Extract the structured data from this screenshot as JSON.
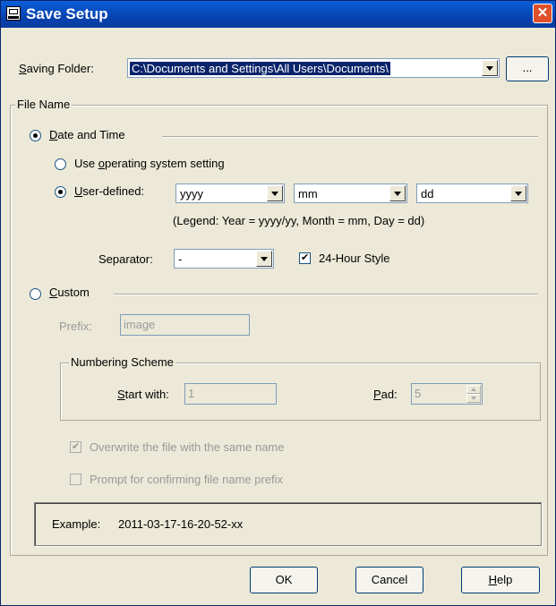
{
  "window": {
    "title": "Save Setup"
  },
  "saving_folder": {
    "label_prefix": "",
    "label_mnemonic": "S",
    "label_rest": "aving Folder:",
    "value": "C:\\Documents and Settings\\All Users\\Documents\\",
    "browse_label": "..."
  },
  "file_name": {
    "group_label": "File Name",
    "date_time": {
      "label_mnemonic": "D",
      "label_rest": "ate and Time",
      "selected": true
    },
    "use_os": {
      "label_pre": "Use ",
      "label_mnemonic": "o",
      "label_rest": "perating system setting",
      "selected": false
    },
    "user_defined": {
      "label_mnemonic": "U",
      "label_rest": "ser-defined:",
      "selected": true
    },
    "year_format": "yyyy",
    "month_format": "mm",
    "day_format": "dd",
    "legend": "(Legend:  Year = yyyy/yy, Month = mm, Day = dd)",
    "separator_label": "Separator:",
    "separator_value": "-",
    "hour24_label": "24-Hour Style",
    "hour24_checked": true,
    "custom": {
      "label_mnemonic": "C",
      "label_rest": "ustom",
      "selected": false
    },
    "prefix_label": "Prefix:",
    "prefix_placeholder": "image",
    "numbering": {
      "group_label": "Numbering Scheme",
      "start_mnemonic": "S",
      "start_rest": "tart with:",
      "start_value": "1",
      "pad_mnemonic": "P",
      "pad_rest": "ad:",
      "pad_value": "5"
    },
    "overwrite_label": "Overwrite the file with the same name",
    "overwrite_checked": true,
    "prompt_label": "Prompt for confirming file name prefix",
    "prompt_checked": false
  },
  "example": {
    "label": "Example:",
    "value": "2011-03-17-16-20-52-xx"
  },
  "buttons": {
    "ok": "OK",
    "cancel": "Cancel",
    "help_mnemonic": "H",
    "help_rest": "elp"
  },
  "icons": {
    "app": "app-window-icon",
    "close": "close-icon",
    "dropdown": "chevron-down-icon"
  }
}
